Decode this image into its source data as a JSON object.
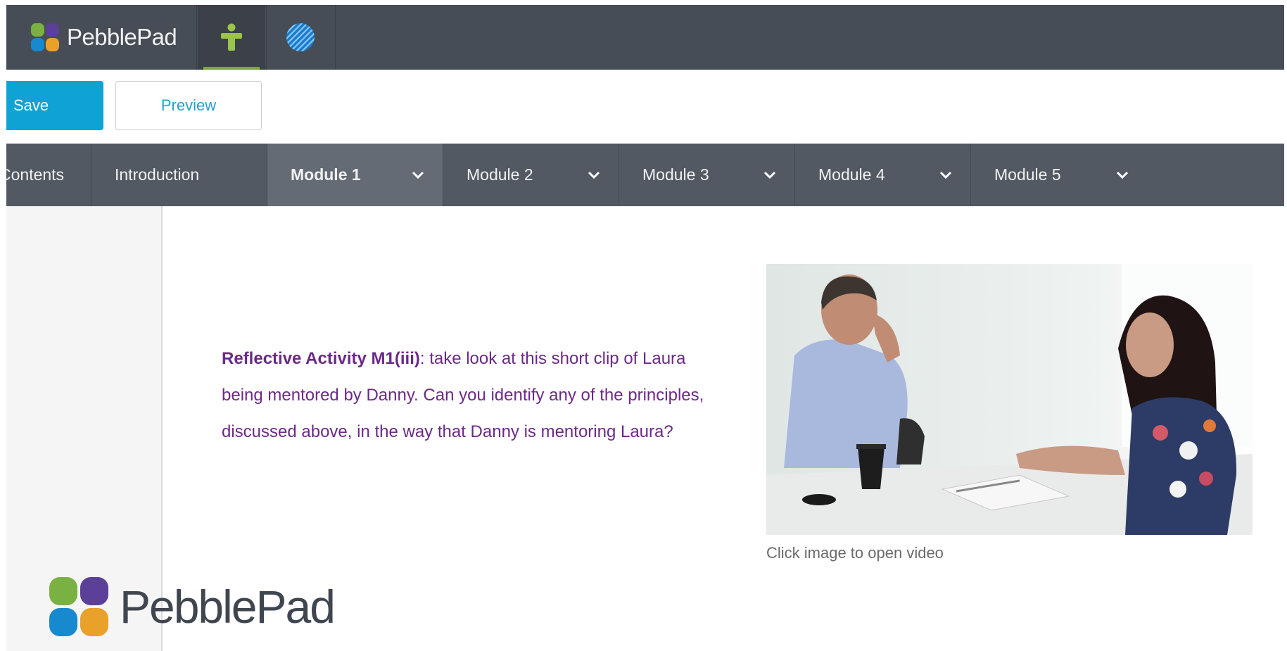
{
  "app": {
    "brand_name": "PebblePad",
    "colors": {
      "topbar": "#474d56",
      "accent_green": "#7ea53a",
      "save_blue": "#0fa3d3",
      "text_purple": "#6b2a86"
    }
  },
  "topbar": {
    "tabs": [
      {
        "icon": "person-icon",
        "active": true
      },
      {
        "icon": "globe-icon",
        "active": false
      }
    ]
  },
  "toolbar": {
    "save_label": "Save",
    "preview_label": "Preview"
  },
  "nav": {
    "items": [
      {
        "label": "Contents",
        "has_dropdown": false,
        "active": false
      },
      {
        "label": "Introduction",
        "has_dropdown": false,
        "active": false
      },
      {
        "label": "Module 1",
        "has_dropdown": true,
        "active": true
      },
      {
        "label": "Module 2",
        "has_dropdown": true,
        "active": false
      },
      {
        "label": "Module 3",
        "has_dropdown": true,
        "active": false
      },
      {
        "label": "Module 4",
        "has_dropdown": true,
        "active": false
      },
      {
        "label": "Module 5",
        "has_dropdown": true,
        "active": false
      }
    ]
  },
  "content": {
    "activity_title": "Reflective Activity M1(iii)",
    "activity_text": ": take look at this short clip of Laura being mentored by Danny.  Can you identify any of the principles, discussed above, in the way that Danny is mentoring Laura?",
    "video_caption": "Click image to open video"
  },
  "footer": {
    "logo_name": "PebblePad"
  }
}
